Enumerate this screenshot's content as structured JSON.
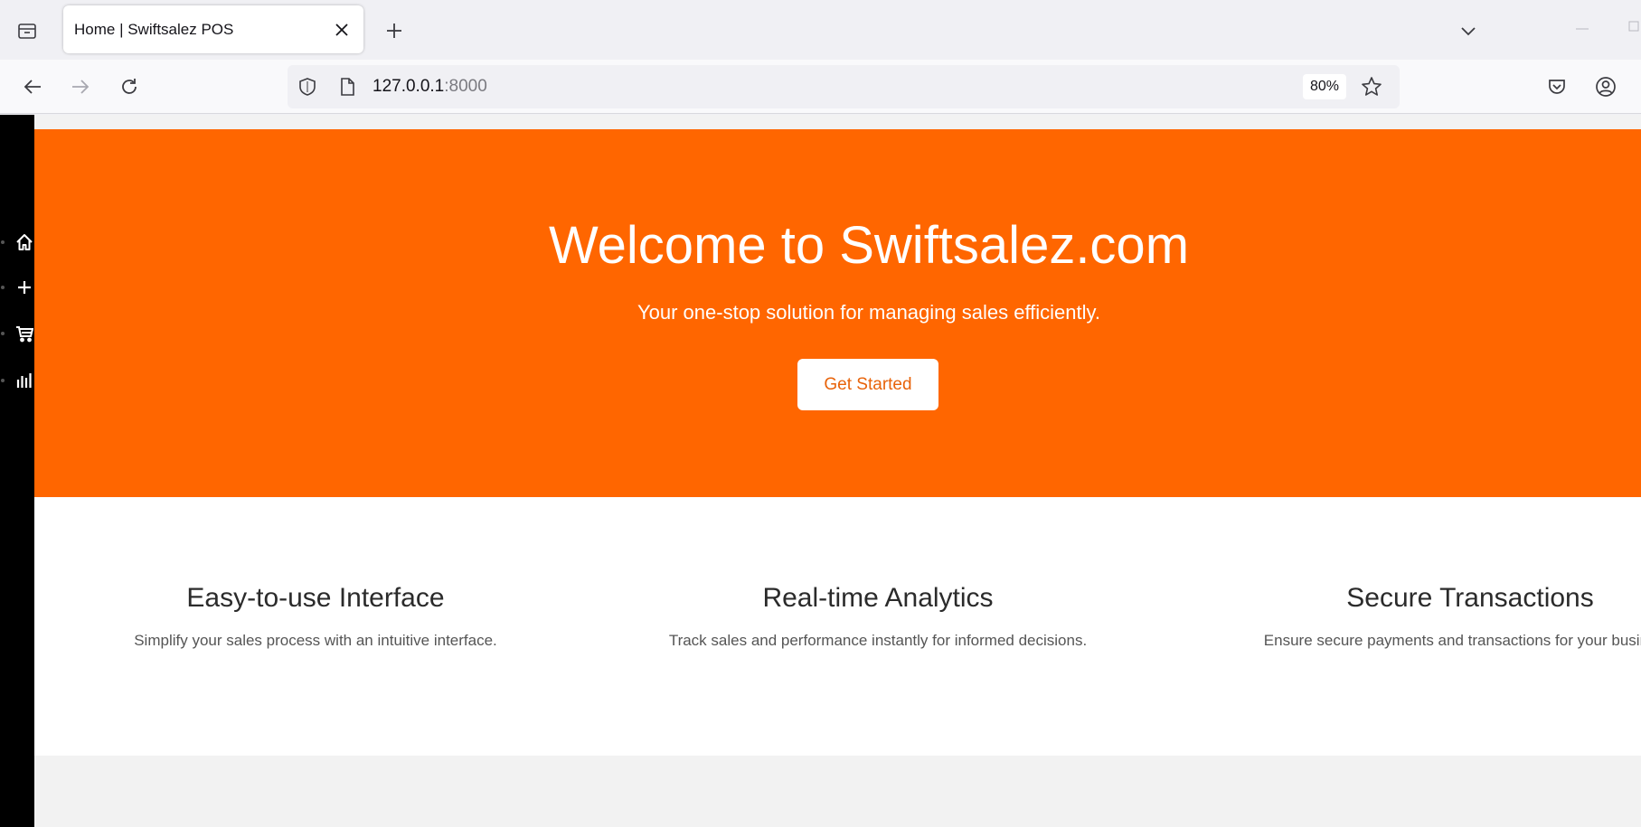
{
  "browser": {
    "tab_title": "Home | Swiftsalez POS",
    "url_host": "127.0.0.1",
    "url_port": ":8000",
    "zoom": "80%"
  },
  "sidebar": {
    "items": [
      {
        "icon": "home-icon"
      },
      {
        "icon": "plus-icon"
      },
      {
        "icon": "cart-icon"
      },
      {
        "icon": "bar-chart-icon"
      }
    ]
  },
  "hero": {
    "title": "Welcome to Swiftsalez.com",
    "subtitle": "Your one-stop solution for managing sales efficiently.",
    "cta_label": "Get Started",
    "background": "#ff6600",
    "cta_color": "#e8630a"
  },
  "features": [
    {
      "title": "Easy-to-use Interface",
      "description": "Simplify your sales process with an intuitive interface."
    },
    {
      "title": "Real-time Analytics",
      "description": "Track sales and performance instantly for informed decisions."
    },
    {
      "title": "Secure Transactions",
      "description": "Ensure secure payments and transactions for your business."
    }
  ]
}
